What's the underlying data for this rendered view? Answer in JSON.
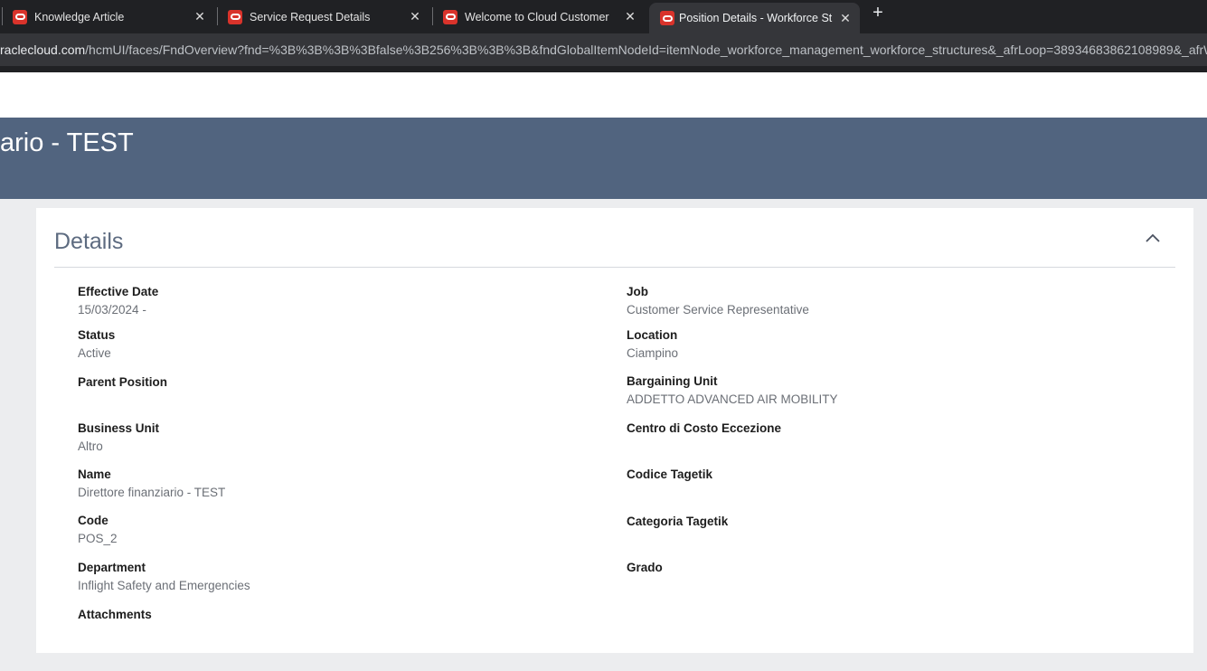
{
  "browser": {
    "tabs": [
      {
        "title": "Knowledge Article",
        "active": false
      },
      {
        "title": "Service Request Details",
        "active": false
      },
      {
        "title": "Welcome to Cloud Customer C",
        "active": false
      },
      {
        "title": "Position Details - Workforce Str",
        "active": true
      }
    ],
    "new_tab_label": "+",
    "close_label": "✕",
    "url_host": "racle cloud.com",
    "url_host_text": "racleloud.com",
    "url_display_host": "racleloud.com",
    "url_full_host": "raclecloud.com",
    "url_path": "/hcmUI/faces/FndOverview?fnd=%3B%3B%3B%3Bfalse%3B256%3B%3B%3B&fndGlobalItemNodeId=itemNode_workforce_management_workforce_structures&_afrLoop=38934683862108989&_afrWind"
  },
  "banner": {
    "title": "ario - TEST"
  },
  "details": {
    "title": "Details",
    "left_fields": [
      {
        "label": "Effective Date",
        "value": "15/03/2024 -"
      },
      {
        "label": "Status",
        "value": "Active"
      },
      {
        "label": "Parent Position",
        "value": ""
      },
      {
        "label": "Business Unit",
        "value": "Altro"
      },
      {
        "label": "Name",
        "value": "Direttore finanziario - TEST"
      },
      {
        "label": "Code",
        "value": "POS_2"
      },
      {
        "label": "Department",
        "value": "Inflight Safety and Emergencies"
      },
      {
        "label": "Attachments",
        "value": ""
      }
    ],
    "right_fields": [
      {
        "label": "Job",
        "value": "Customer Service Representative"
      },
      {
        "label": "Location",
        "value": "Ciampino"
      },
      {
        "label": "Bargaining Unit",
        "value": "ADDETTO ADVANCED AIR MOBILITY"
      },
      {
        "label": "Centro di Costo Eccezione",
        "value": ""
      },
      {
        "label": "Codice Tagetik",
        "value": ""
      },
      {
        "label": "Categoria Tagetik",
        "value": ""
      },
      {
        "label": "Grado",
        "value": ""
      }
    ]
  },
  "colors": {
    "banner": "#51647f",
    "favicon": "#d9332b",
    "tab_bg": "#202124"
  }
}
